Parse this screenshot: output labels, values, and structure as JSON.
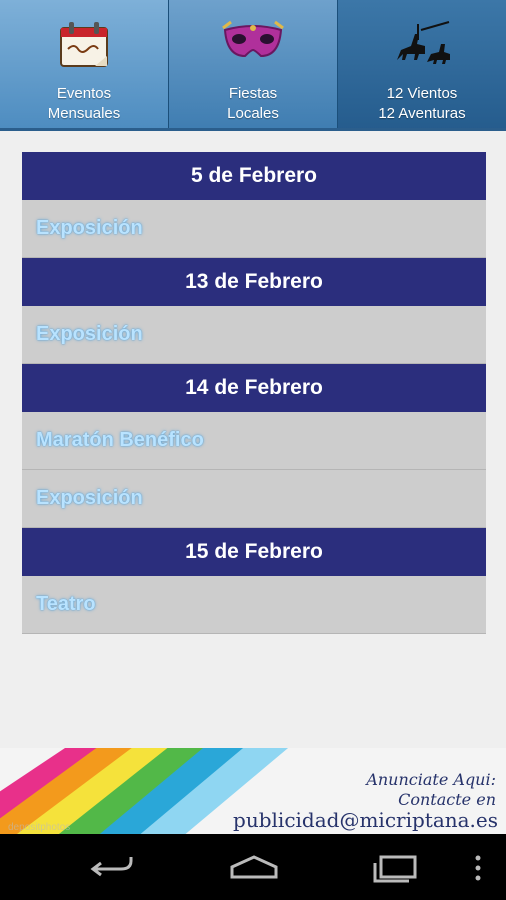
{
  "tabs": [
    {
      "line1": "Eventos",
      "line2": "Mensuales",
      "icon": "calendar-icon"
    },
    {
      "line1": "Fiestas",
      "line2": "Locales",
      "icon": "mask-icon"
    },
    {
      "line1": "12 Vientos",
      "line2": "12 Aventuras",
      "icon": "quixote-rider-icon"
    }
  ],
  "events": [
    {
      "date": "5 de Febrero",
      "items": [
        "Exposición"
      ]
    },
    {
      "date": "13 de Febrero",
      "items": [
        "Exposición"
      ]
    },
    {
      "date": "14 de Febrero",
      "items": [
        "Maratón Benéfico",
        "Exposición"
      ]
    },
    {
      "date": "15 de Febrero",
      "items": [
        "Teatro"
      ]
    }
  ],
  "ad": {
    "line1": "Anunciate Aqui:",
    "line2": "Contacte en",
    "line3": "publicidad@micriptana.es",
    "watermark": "depositphotos"
  },
  "colors": {
    "header_bg": "#2b2e7d",
    "event_bg": "#cdcdcd",
    "event_text": "#b9e3ff"
  },
  "navbar": {
    "icons": [
      "back-icon",
      "home-icon",
      "recent-apps-icon",
      "overflow-menu-icon"
    ]
  }
}
